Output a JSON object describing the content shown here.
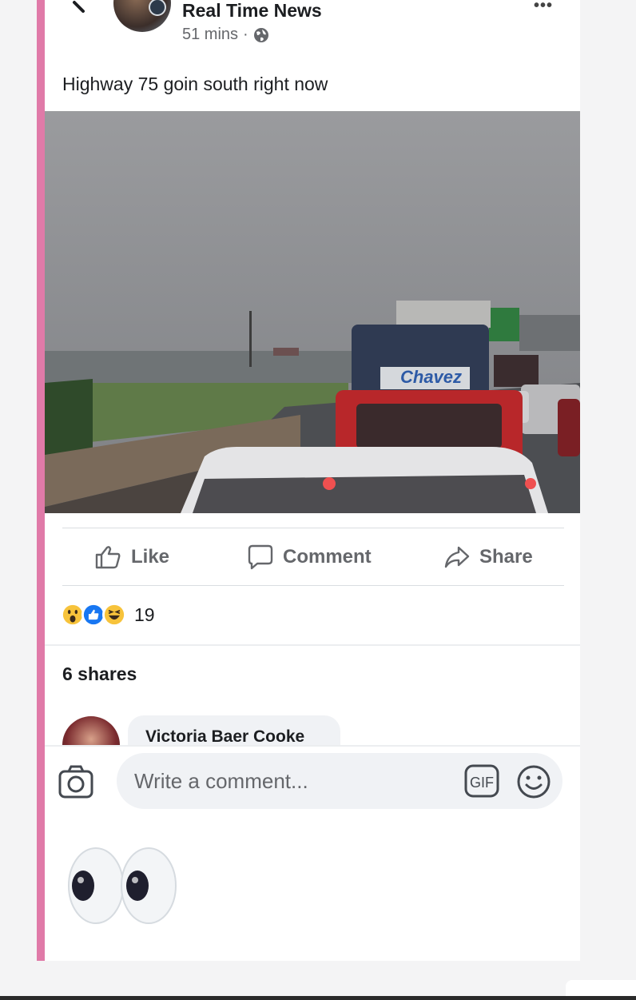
{
  "post": {
    "page_name": "Real Time News",
    "time": "51 mins",
    "separator": "·",
    "text": "Highway 75 goin south right now",
    "photo_sign_text": "Chavez"
  },
  "actions": {
    "like": "Like",
    "comment": "Comment",
    "share": "Share"
  },
  "reactions": {
    "icons": [
      "wow-icon",
      "like-icon",
      "haha-icon"
    ],
    "count": "19"
  },
  "shares": "6 shares",
  "comment": {
    "author": "Victoria Baer Cooke"
  },
  "composer": {
    "placeholder": "Write a comment...",
    "gif_label": "GIF"
  },
  "colors": {
    "accent_bar": "#e07aa8",
    "like_blue": "#1877f2",
    "muted_text": "#65676b"
  }
}
